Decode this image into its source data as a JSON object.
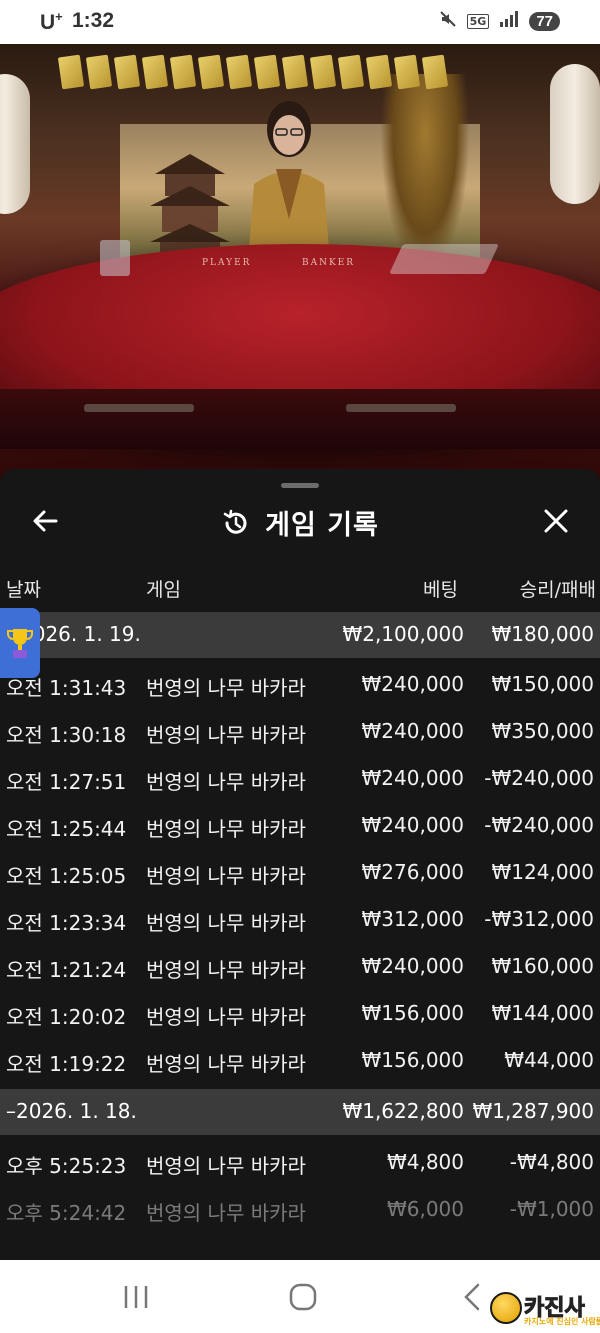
{
  "status_bar": {
    "carrier": "U",
    "carrier_sup": "+",
    "time": "1:32",
    "network": "5G",
    "battery": "77"
  },
  "video": {
    "player_label": "PLAYER",
    "banker_label": "BANKER"
  },
  "sheet": {
    "title": "게임 기록",
    "columns": {
      "date": "날짜",
      "game": "게임",
      "bet": "베팅",
      "result": "승리/패배"
    },
    "groups": [
      {
        "date": "2026. 1. 19.",
        "total_bet": "₩2,100,000",
        "total_result": "₩180,000",
        "rows": [
          {
            "time": "오전 1:31:43",
            "game": "번영의 나무 바카라",
            "bet": "₩240,000",
            "result": "₩150,000"
          },
          {
            "time": "오전 1:30:18",
            "game": "번영의 나무 바카라",
            "bet": "₩240,000",
            "result": "₩350,000"
          },
          {
            "time": "오전 1:27:51",
            "game": "번영의 나무 바카라",
            "bet": "₩240,000",
            "result": "-₩240,000"
          },
          {
            "time": "오전 1:25:44",
            "game": "번영의 나무 바카라",
            "bet": "₩240,000",
            "result": "-₩240,000"
          },
          {
            "time": "오전 1:25:05",
            "game": "번영의 나무 바카라",
            "bet": "₩276,000",
            "result": "₩124,000"
          },
          {
            "time": "오전 1:23:34",
            "game": "번영의 나무 바카라",
            "bet": "₩312,000",
            "result": "-₩312,000"
          },
          {
            "time": "오전 1:21:24",
            "game": "번영의 나무 바카라",
            "bet": "₩240,000",
            "result": "₩160,000"
          },
          {
            "time": "오전 1:20:02",
            "game": "번영의 나무 바카라",
            "bet": "₩156,000",
            "result": "₩144,000"
          },
          {
            "time": "오전 1:19:22",
            "game": "번영의 나무 바카라",
            "bet": "₩156,000",
            "result": "₩44,000"
          }
        ]
      },
      {
        "date": "–2026. 1. 18.",
        "total_bet": "₩1,622,800",
        "total_result": "₩1,287,900",
        "rows": [
          {
            "time": "오후 5:25:23",
            "game": "번영의 나무 바카라",
            "bet": "₩4,800",
            "result": "-₩4,800"
          },
          {
            "time": "오후 5:24:42",
            "game": "번영의 나무 바카라",
            "bet": "₩6,000",
            "result": "-₩1,000"
          }
        ]
      }
    ]
  },
  "watermark": {
    "name": "카진사",
    "tagline": "카지노에 진심인 사람들"
  },
  "colors": {
    "sheet_bg": "#161616",
    "date_row_bg": "#3b3b3b",
    "felt": "#8c141a",
    "trophy_tab": "#3d6fd6",
    "watermark_gold": "#e8a800"
  }
}
